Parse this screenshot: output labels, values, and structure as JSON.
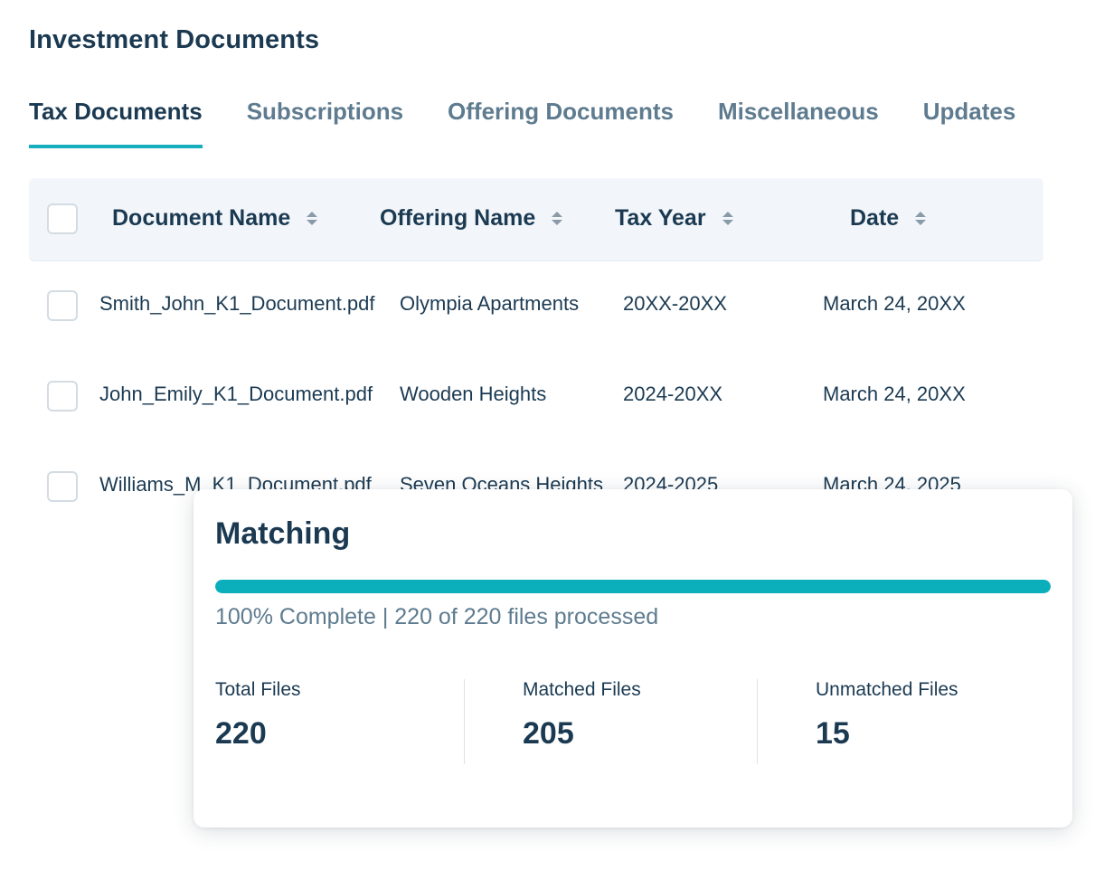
{
  "page": {
    "title": "Investment Documents"
  },
  "tabs": [
    {
      "label": "Tax Documents",
      "active": true
    },
    {
      "label": "Subscriptions",
      "active": false
    },
    {
      "label": "Offering Documents",
      "active": false
    },
    {
      "label": "Miscellaneous",
      "active": false
    },
    {
      "label": "Updates",
      "active": false
    }
  ],
  "table": {
    "columns": [
      {
        "label": "Document Name",
        "sortable": true
      },
      {
        "label": "Offering Name",
        "sortable": true
      },
      {
        "label": "Tax Year",
        "sortable": true
      },
      {
        "label": "Date",
        "sortable": true
      }
    ],
    "rows": [
      {
        "document": "Smith_John_K1_Document.pdf",
        "offering": "Olympia Apartments",
        "tax_year": "20XX-20XX",
        "date": "March 24, 20XX"
      },
      {
        "document": "John_Emily_K1_Document.pdf",
        "offering": "Wooden Heights",
        "tax_year": "2024-20XX",
        "date": "March 24, 20XX"
      },
      {
        "document": "Williams_M_K1_Document.pdf",
        "offering": "Seven Oceans Heights",
        "tax_year": "2024-2025",
        "date": "March 24, 2025"
      }
    ]
  },
  "matching": {
    "title": "Matching",
    "progress_percent": 100,
    "progress_text": "100% Complete | 220 of 220 files processed",
    "stats": [
      {
        "label": "Total Files",
        "value": "220"
      },
      {
        "label": "Matched Files",
        "value": "205"
      },
      {
        "label": "Unmatched Files",
        "value": "15"
      }
    ]
  },
  "colors": {
    "accent": "#17aebd",
    "progress": "#0aafbb",
    "text_primary": "#1b3a52",
    "text_muted": "#5e7b8f",
    "header_bg": "#f2f6fa"
  }
}
